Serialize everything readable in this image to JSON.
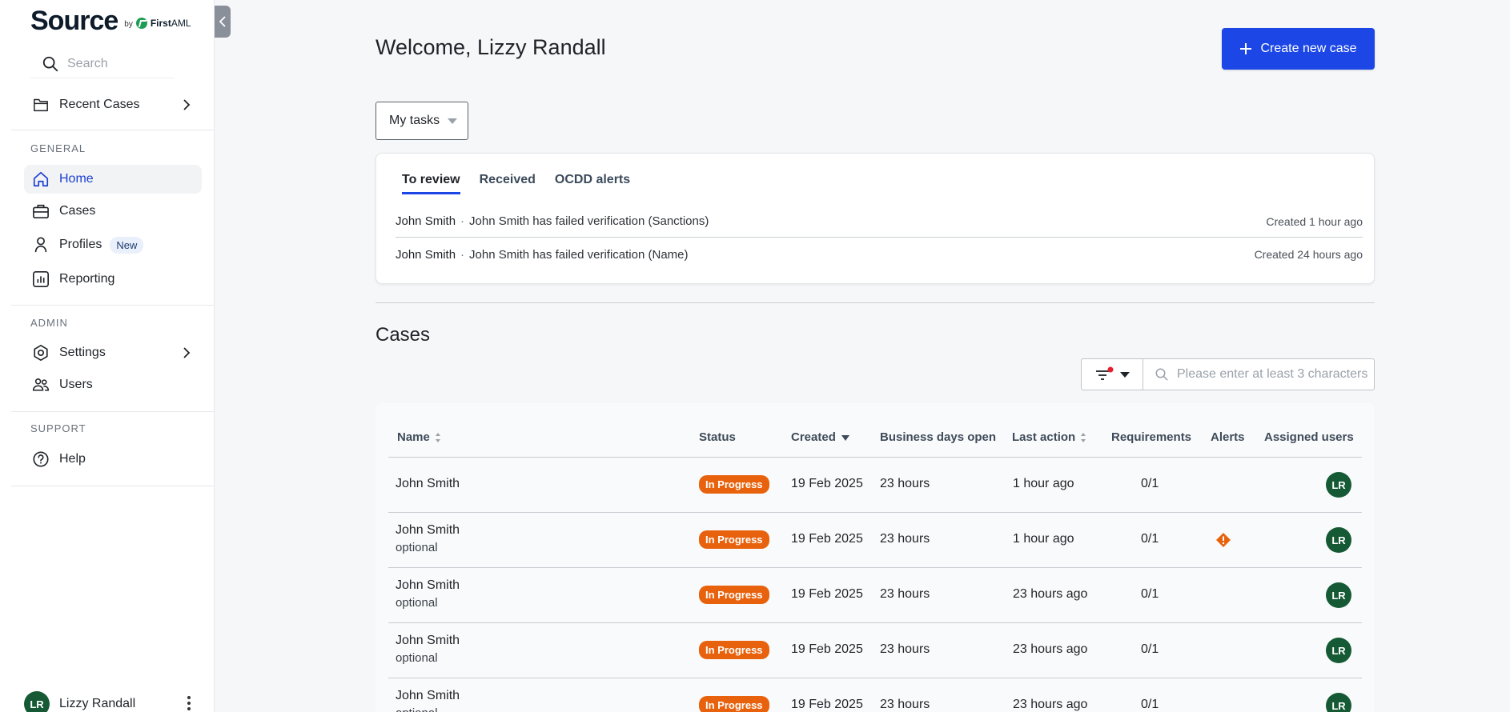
{
  "brand": {
    "name": "Source",
    "by": "by",
    "partner_first": "First",
    "partner_second": "AML"
  },
  "sidebar": {
    "search_placeholder": "Search",
    "recent_cases": "Recent Cases",
    "general_label": "GENERAL",
    "general_items": [
      {
        "label": "Home",
        "icon": "home-icon",
        "active": true
      },
      {
        "label": "Cases",
        "icon": "briefcase-icon"
      },
      {
        "label": "Profiles",
        "icon": "person-icon",
        "badge": "New"
      },
      {
        "label": "Reporting",
        "icon": "chart-icon"
      }
    ],
    "admin_label": "ADMIN",
    "admin_items": [
      {
        "label": "Settings",
        "icon": "gear-icon"
      },
      {
        "label": "Users",
        "icon": "users-icon"
      }
    ],
    "support_label": "SUPPORT",
    "support_items": [
      {
        "label": "Help",
        "icon": "help-icon"
      }
    ],
    "user": {
      "initials": "LR",
      "name": "Lizzy Randall"
    }
  },
  "main": {
    "welcome": "Welcome, Lizzy Randall",
    "create_button": "Create new case",
    "tasks_dropdown": "My tasks",
    "tabs": [
      "To review",
      "Received",
      "OCDD alerts"
    ],
    "tasks": [
      {
        "who": "John Smith",
        "message": "John Smith has failed verification (Sanctions)",
        "time": "Created 1 hour ago"
      },
      {
        "who": "John Smith",
        "message": "John Smith has failed verification (Name)",
        "time": "Created 24 hours ago"
      }
    ],
    "cases_title": "Cases",
    "cases_search_placeholder": "Please enter at least 3 characters",
    "columns": {
      "name": "Name",
      "status": "Status",
      "created": "Created",
      "days_open": "Business days open",
      "last_action": "Last action",
      "requirements": "Requirements",
      "alerts": "Alerts",
      "assigned": "Assigned users"
    },
    "rows": [
      {
        "name": "John Smith",
        "sub": "",
        "status": "In Progress",
        "created": "19 Feb 2025",
        "days_open": "23 hours",
        "last_action": "1 hour ago",
        "requirements": "0/1",
        "alert": false,
        "assigned": "LR"
      },
      {
        "name": "John Smith",
        "sub": "optional",
        "status": "In Progress",
        "created": "19 Feb 2025",
        "days_open": "23 hours",
        "last_action": "1 hour ago",
        "requirements": "0/1",
        "alert": true,
        "assigned": "LR"
      },
      {
        "name": "John Smith",
        "sub": "optional",
        "status": "In Progress",
        "created": "19 Feb 2025",
        "days_open": "23 hours",
        "last_action": "23 hours ago",
        "requirements": "0/1",
        "alert": false,
        "assigned": "LR"
      },
      {
        "name": "John Smith",
        "sub": "optional",
        "status": "In Progress",
        "created": "19 Feb 2025",
        "days_open": "23 hours",
        "last_action": "23 hours ago",
        "requirements": "0/1",
        "alert": false,
        "assigned": "LR"
      },
      {
        "name": "John Smith",
        "sub": "optional",
        "status": "In Progress",
        "created": "19 Feb 2025",
        "days_open": "23 hours",
        "last_action": "23 hours ago",
        "requirements": "0/1",
        "alert": false,
        "assigned": "LR"
      }
    ]
  },
  "colors": {
    "accent": "#1c47e6",
    "status_in_progress": "#e8620d",
    "avatar": "#155a35",
    "alert": "#e8620d"
  }
}
